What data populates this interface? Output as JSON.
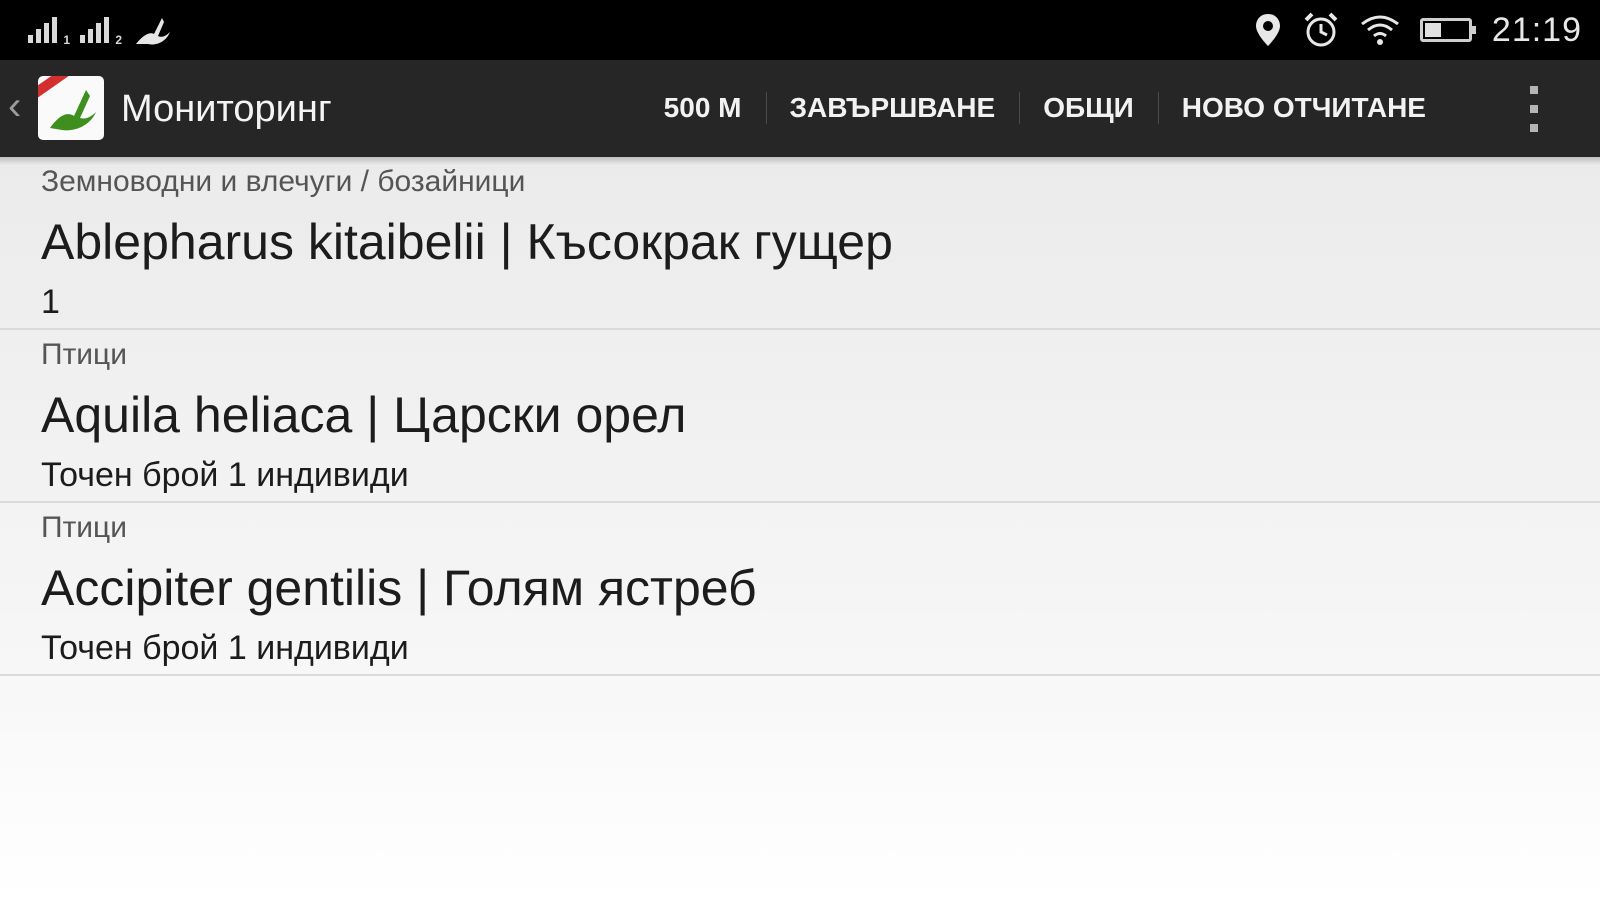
{
  "status_bar": {
    "signal1_sub": "1",
    "signal2_sub": "2",
    "time": "21:19",
    "icons": [
      "signal-icon",
      "signal-icon",
      "bird-notification-icon",
      "location-pin-icon",
      "alarm-clock-icon",
      "wifi-icon",
      "battery-icon"
    ],
    "battery_level": 0.35
  },
  "action_bar": {
    "title": "Мониторинг",
    "actions": [
      {
        "label": "500 М"
      },
      {
        "label": "ЗАВЪРШВАНЕ"
      },
      {
        "label": "ОБЩИ"
      },
      {
        "label": "НОВО ОТЧИТАНЕ"
      }
    ],
    "icons": [
      "back-caret-icon",
      "app-logo-icon",
      "overflow-menu-icon"
    ]
  },
  "observations": [
    {
      "category": "Земноводни и влечуги / бозайници",
      "name": "Ablepharus kitaibelii | Късокрак гущер",
      "count": "1"
    },
    {
      "category": "Птици",
      "name": "Aquila heliaca | Царски орел",
      "count": "Точен брой 1 индивиди"
    },
    {
      "category": "Птици",
      "name": "Accipiter gentilis | Голям ястреб",
      "count": "Точен брой 1 индивиди"
    }
  ],
  "colors": {
    "status_bar_bg": "#000000",
    "action_bar_bg": "#262626",
    "accent_green": "#3f8f1e",
    "ribbon_red": "#d32f2f"
  }
}
